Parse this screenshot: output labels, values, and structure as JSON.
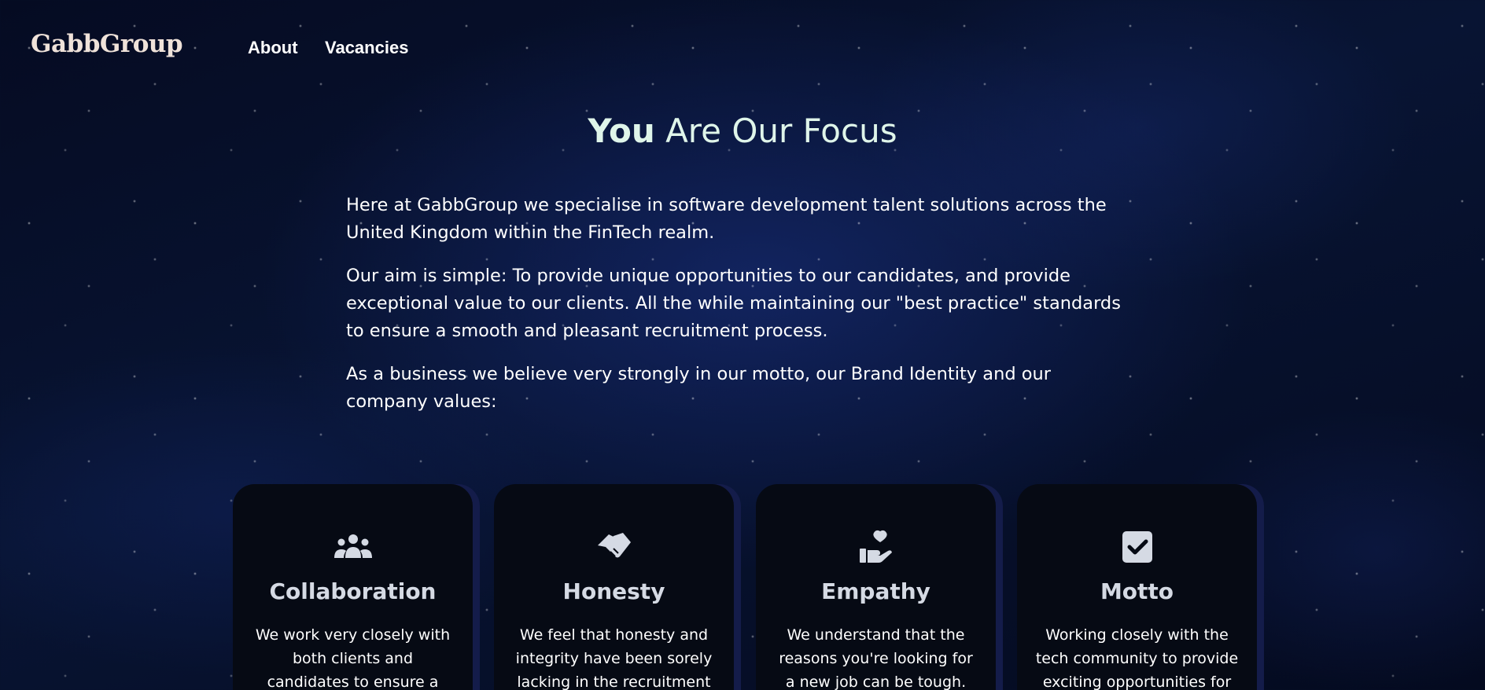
{
  "nav": {
    "logo": "GabbGroup",
    "links": [
      {
        "label": "About"
      },
      {
        "label": "Vacancies"
      }
    ]
  },
  "hero": {
    "heading_strong": "You",
    "heading_rest": " Are Our Focus",
    "paragraphs": [
      "Here at GabbGroup we specialise in software development talent solutions across the United Kingdom within the FinTech realm.",
      "Our aim is simple: To provide unique opportunities to our candidates, and provide exceptional value to our clients. All the while maintaining our \"best practice\" standards to ensure a smooth and pleasant recruitment process.",
      "As a business we believe very strongly in our motto, our Brand Identity and our company values:"
    ]
  },
  "values": [
    {
      "icon": "people-group-icon",
      "title": "Collaboration",
      "text": "We work very closely with both clients and candidates to ensure a smooth"
    },
    {
      "icon": "handshake-icon",
      "title": "Honesty",
      "text": "We feel that honesty and integrity have been sorely lacking in the recruitment"
    },
    {
      "icon": "hand-holding-heart-icon",
      "title": "Empathy",
      "text": "We understand that the reasons you're looking for a new job can be tough. We"
    },
    {
      "icon": "square-check-icon",
      "title": "Motto",
      "text": "Working closely with the tech community to provide exciting opportunities for"
    }
  ],
  "colors": {
    "background": "#03081a",
    "card": "#060a14",
    "card_edge": "#141c4a",
    "heading": "#dff5ea",
    "logo": "#efe2d9",
    "icon": "#d5dae4"
  }
}
